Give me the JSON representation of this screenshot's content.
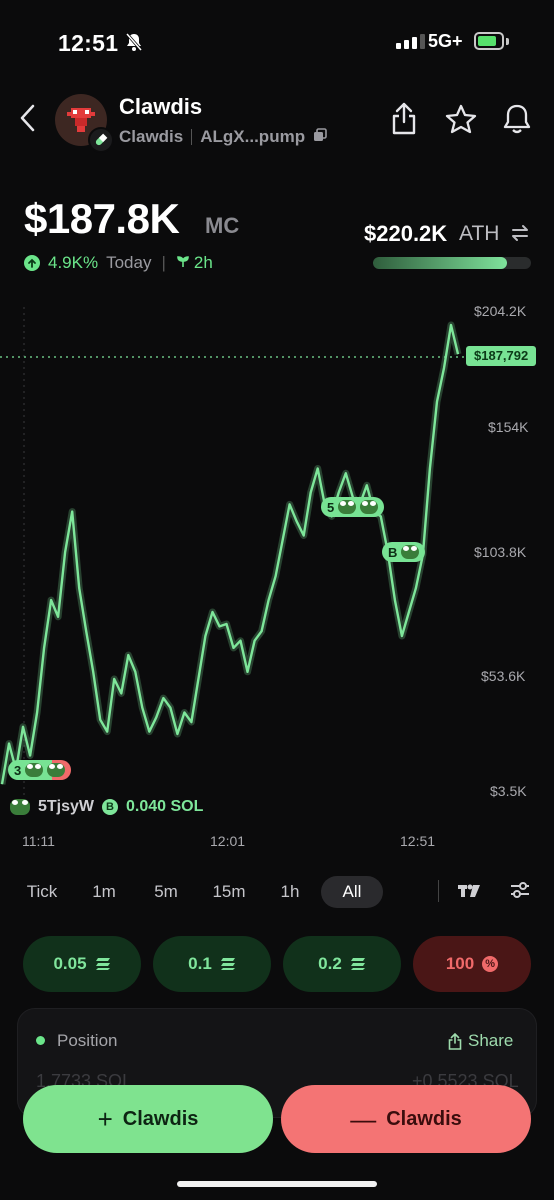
{
  "status_bar": {
    "time": "12:51",
    "network": "5G+"
  },
  "token": {
    "name": "Clawdis",
    "ticker": "Clawdis",
    "address": "ALgX...pump"
  },
  "price": {
    "market_cap": "$187.8K",
    "mc_unit": "MC",
    "change": "4.9K%",
    "change_period": "Today",
    "age": "2h",
    "ath_value": "$220.2K",
    "ath_label": "ATH",
    "ath_progress": 0.85
  },
  "chart_data": {
    "type": "line",
    "y_ticks": [
      "$204.2K",
      "$154K",
      "$103.8K",
      "$53.6K",
      "$3.5K"
    ],
    "x_ticks": [
      "11:11",
      "12:01",
      "12:51"
    ],
    "current_price_label": "$187,792",
    "ylim": [
      3500,
      204200
    ],
    "series": [
      {
        "color": "#7ee69a",
        "values": [
          8000,
          25000,
          14000,
          32000,
          20000,
          38000,
          65000,
          85000,
          78000,
          105000,
          122000,
          90000,
          72000,
          55000,
          35000,
          30000,
          52000,
          46000,
          62000,
          55000,
          40000,
          30000,
          36000,
          44000,
          40000,
          29000,
          38000,
          34000,
          52000,
          70000,
          80000,
          74000,
          75000,
          65000,
          68000,
          55000,
          68000,
          72000,
          85000,
          95000,
          110000,
          125000,
          118000,
          112000,
          130000,
          140000,
          125000,
          120000,
          130000,
          138000,
          128000,
          125000,
          133000,
          122000,
          120000,
          105000,
          85000,
          70000,
          80000,
          90000,
          104000,
          140000,
          168000,
          182000,
          200000,
          187792
        ]
      }
    ],
    "markers": [
      {
        "label": "3",
        "color": "#7ee69a"
      },
      {
        "label": "5",
        "color": "#7ee69a"
      },
      {
        "label": "B",
        "color": "#7ee69a"
      }
    ]
  },
  "trade": {
    "wallet": "5TjsyW",
    "side_icon": "B",
    "amount": "0.040 SOL"
  },
  "timeframes": [
    "Tick",
    "1m",
    "5m",
    "15m",
    "1h",
    "All"
  ],
  "active_timeframe": "All",
  "quick_buy": [
    {
      "label": "0.05"
    },
    {
      "label": "0.1"
    },
    {
      "label": "0.2"
    }
  ],
  "quick_sell": {
    "label": "100"
  },
  "position": {
    "label": "Position",
    "share_label": "Share",
    "amount": "1.7733 SOL",
    "pnl": "+0.5523 SOL"
  },
  "actions": {
    "buy_label": "Clawdis",
    "sell_label": "Clawdis"
  },
  "colors": {
    "accent": "#7ee69a",
    "sell": "#f47474",
    "background": "#0b0b0c"
  }
}
